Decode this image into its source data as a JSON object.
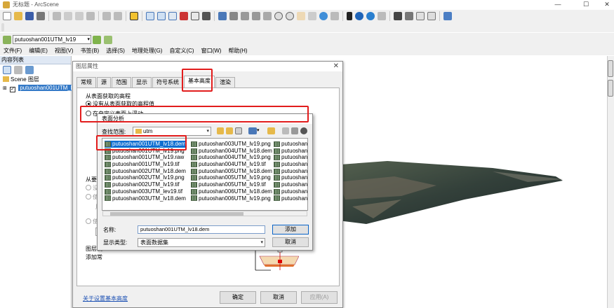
{
  "window": {
    "title": "无标题 - ArcScene",
    "controls": [
      "—",
      "☐",
      "✕"
    ]
  },
  "layer_combo": {
    "value": "putuoshan001UTM_lv19"
  },
  "menu": [
    "文件(F)",
    "编辑(E)",
    "视图(V)",
    "书签(B)",
    "选择(S)",
    "地理处理(G)",
    "自定义(C)",
    "窗口(W)",
    "帮助(H)"
  ],
  "toc": {
    "title": "内容列表",
    "scene_layer": "Scene 图层",
    "layer": "putuoshan001UTM_lv19"
  },
  "layer_properties": {
    "title": "图层属性",
    "tabs": [
      "常规",
      "源",
      "范围",
      "显示",
      "符号系统",
      "基本高度",
      "渲染"
    ],
    "active_tab": "基本高度",
    "section_surface": "从表面获取的高程",
    "radio_none": "没有从表面获取的高程值",
    "radio_float": "在自定义表面上浮动",
    "section_features": "从要素",
    "feat_none": "没",
    "feat_use": "使",
    "feat_use_label": "用",
    "feat_use2": "使",
    "feat_dropdown": "0",
    "section_offset": "图层偏",
    "offset_label": "添加常",
    "link": "关于设置基本高度",
    "buttons": {
      "ok": "确定",
      "cancel": "取消",
      "apply": "应用(A)"
    }
  },
  "file_dialog": {
    "title": "表面分析",
    "lookin_label": "查找范围:",
    "lookin_value": "utm",
    "files_col1": [
      "putuoshan001UTM_lv18.dem",
      "putuoshan001UTM_lv19.png",
      "putuoshan001UTM_lv19.raw",
      "putuoshan001UTM_lv19.tif",
      "putuoshan002UTM_lv18.dem",
      "putuoshan002UTM_lv19.png",
      "putuoshan002UTM_lv19.tif",
      "putuoshan003UTM_lev19.tif",
      "putuoshan003UTM_lv18.dem"
    ],
    "files_col2": [
      "putuoshan003UTM_lv19.png",
      "putuoshan004UTM_lv18.dem",
      "putuoshan004UTM_lv19.png",
      "putuoshan004UTM_lv19.tif",
      "putuoshan005UTM_lv18.dem",
      "putuoshan005UTM_lv19.png",
      "putuoshan005UTM_lv19.tif",
      "putuoshan006UTM_lv18.dem",
      "putuoshan006UTM_lv19.png"
    ],
    "files_col3": [
      "putuoshan0",
      "putuoshan0",
      "putuoshan0",
      "putuoshan0",
      "putuoshan0",
      "putuoshan0",
      "putuoshan0",
      "putuoshan0",
      "putuoshan0"
    ],
    "name_label": "名称:",
    "name_value": "putuoshan001UTM_lv18.dem",
    "type_label": "显示类型:",
    "type_value": "表面数据集",
    "add_button": "添加",
    "cancel_button": "取消"
  },
  "colors": {
    "highlight": "#0f6fd1",
    "annotation": "#e21d1d",
    "toc_selected": "#3379c7"
  }
}
